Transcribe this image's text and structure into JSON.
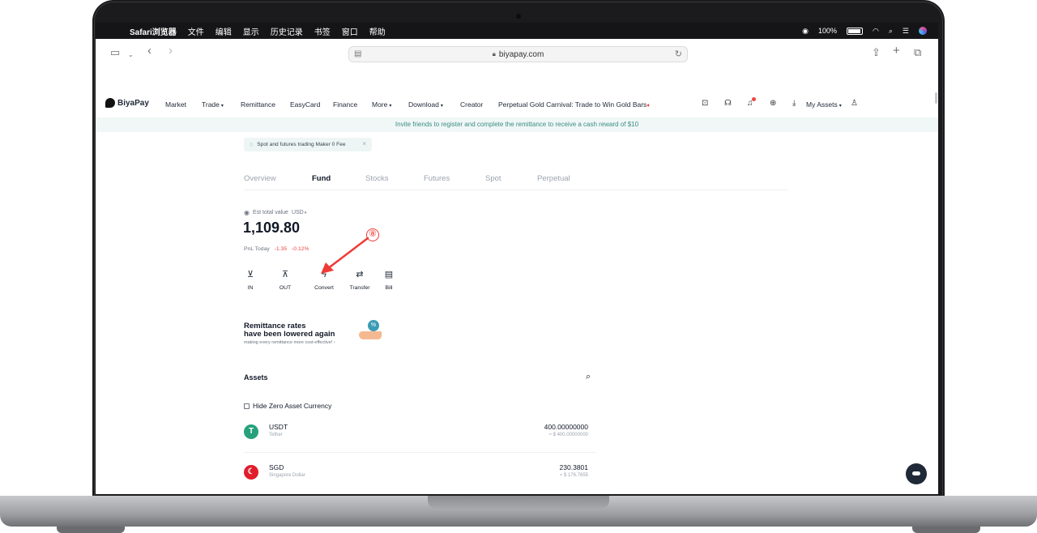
{
  "menubar": {
    "app": "Safari浏览器",
    "items": [
      "文件",
      "编辑",
      "显示",
      "历史记录",
      "书签",
      "窗口",
      "帮助"
    ],
    "battery": "100%"
  },
  "browser": {
    "url": "biyapay.com"
  },
  "site": {
    "brand": "BiyaPay",
    "nav": {
      "market": "Market",
      "trade": "Trade",
      "remittance": "Remittance",
      "easycard": "EasyCard",
      "finance": "Finance",
      "more": "More",
      "download": "Download",
      "creator": "Creator",
      "promo": "Perpetual Gold Carnival: Trade to Win Gold Bars",
      "my_assets": "My Assets"
    },
    "invite_banner": "Invite friends to register and complete the remittance to receive a cash reward of $10"
  },
  "notice": {
    "text": "Spot and futures trading Maker 0 Fee"
  },
  "tabs": [
    "Overview",
    "Fund",
    "Stocks",
    "Futures",
    "Spot",
    "Perpetual"
  ],
  "active_tab": "Fund",
  "summary": {
    "est_label": "Est total value",
    "currency": "USD",
    "total": "1,109.80",
    "pnl_label": "PnL Today",
    "pnl_value": "-1.35",
    "pnl_percent": "-0.12%"
  },
  "actions": [
    "IN",
    "OUT",
    "Convert",
    "Transfer",
    "Bill"
  ],
  "annotation": {
    "number": "⑧",
    "color": "#ef3b36"
  },
  "ad": {
    "line1": "Remittance rates",
    "line2": "have been lowered again",
    "line3": "making every remittance more cost-effective! ›"
  },
  "assets": {
    "title": "Assets",
    "hide_zero": "Hide Zero Asset Currency",
    "rows": [
      {
        "symbol": "USDT",
        "name": "Tether",
        "amount": "400.00000000",
        "usd": "≈ $ 400.00000000",
        "icon_color": "#26a17b",
        "icon": "T"
      },
      {
        "symbol": "SGD",
        "name": "Singapore Dollar",
        "amount": "230.3801",
        "usd": "≈ $ 176.7655",
        "icon_color": "#e11d2c",
        "icon": "☾"
      }
    ]
  },
  "colors": {
    "accent": "#3b8d85",
    "negative": "#ef4444"
  }
}
